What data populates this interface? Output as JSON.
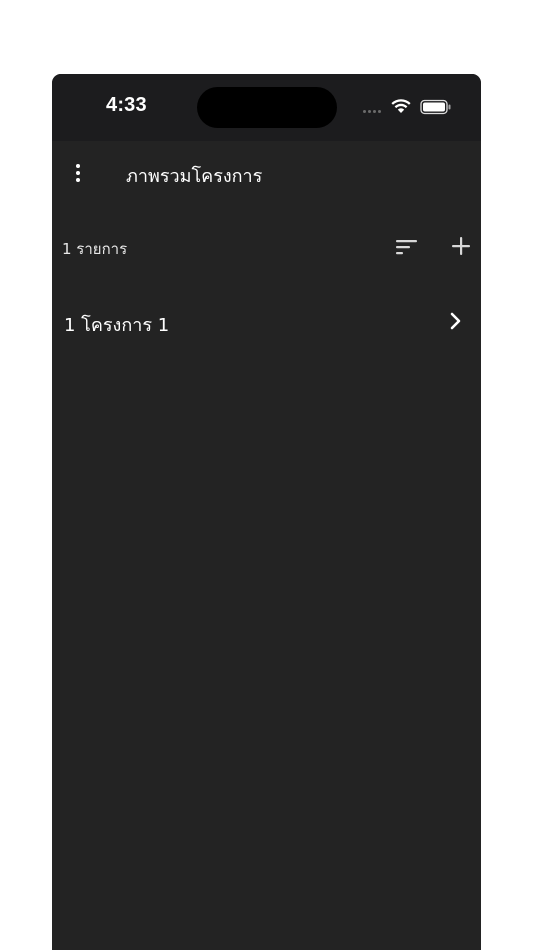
{
  "status_bar": {
    "time": "4:33",
    "icons": [
      "cellular-signal-icon",
      "wifi-icon",
      "battery-icon"
    ]
  },
  "app_bar": {
    "title": "ภาพรวมโครงการ",
    "menu_icon": "more-vertical-icon"
  },
  "toolbar": {
    "count_label": "1 รายการ",
    "sort_icon": "sort-icon",
    "add_icon": "plus-icon"
  },
  "projects": [
    {
      "label": "1 โครงการ 1"
    }
  ],
  "colors": {
    "background": "#232323",
    "status_bar": "#1c1c1e",
    "text": "#ffffff",
    "page": "#ffffff"
  }
}
